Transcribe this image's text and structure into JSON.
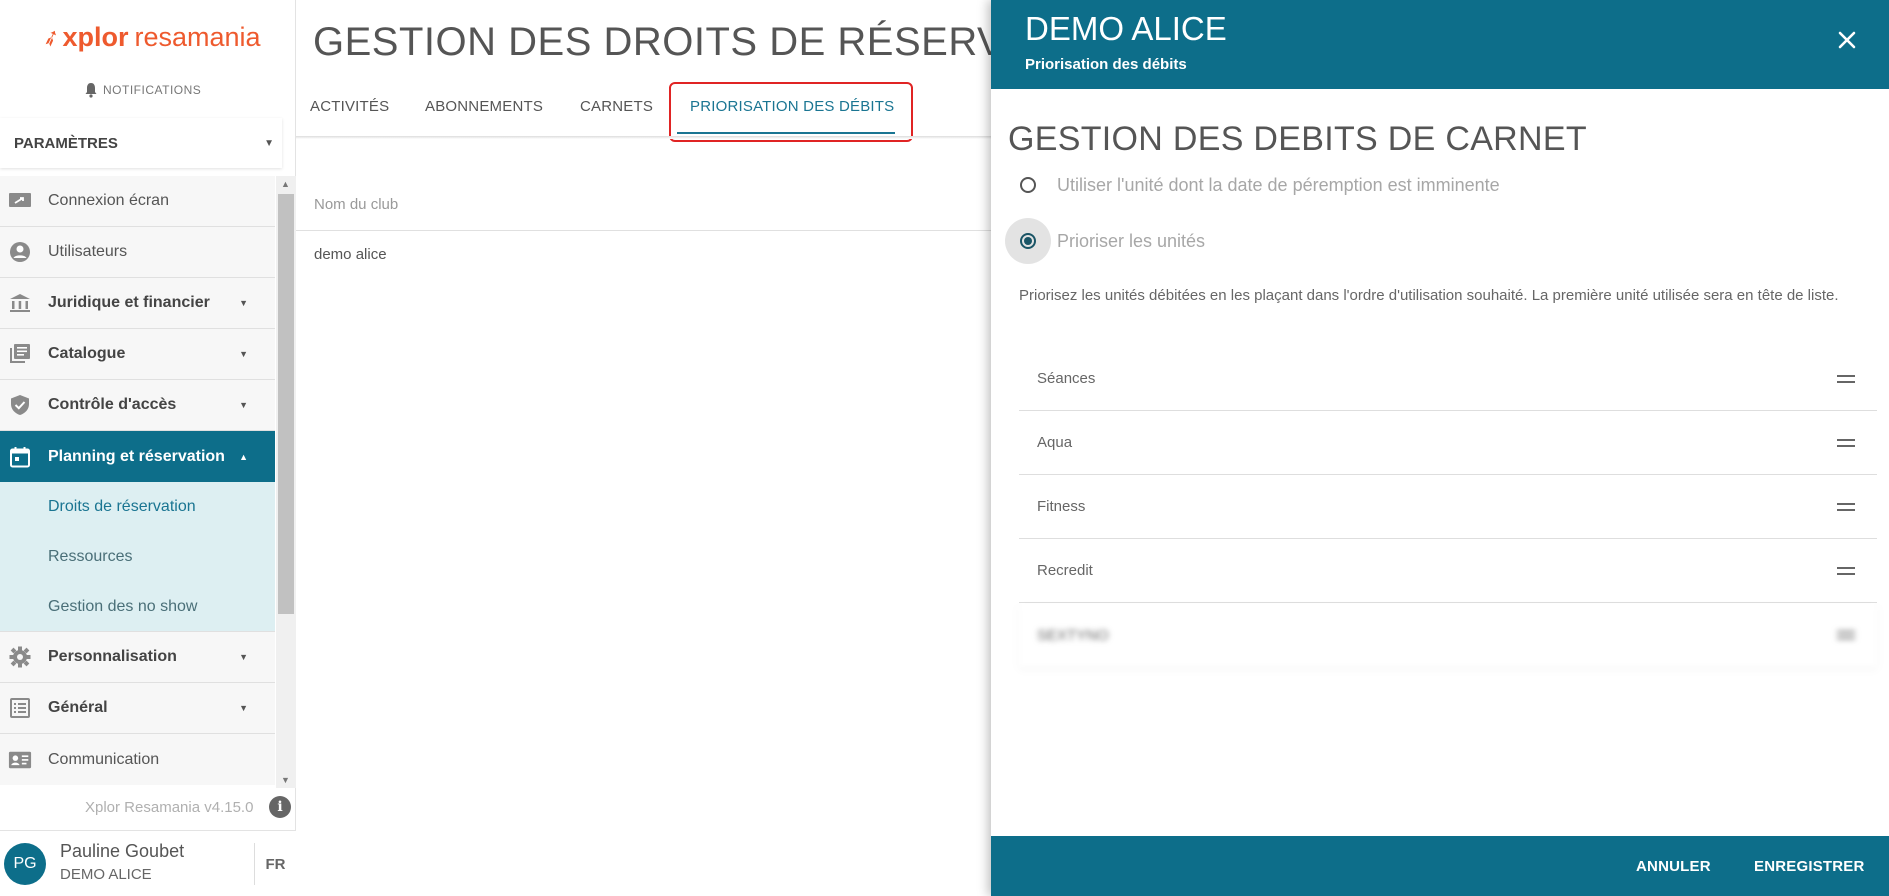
{
  "brand": {
    "logo_mark": "xplor",
    "logo_text": "resamania",
    "accent": "#0d6e8a",
    "logo_color": "#ee5a2e"
  },
  "notifications": {
    "label": "NOTIFICATIONS",
    "icon": "bell-icon"
  },
  "params": {
    "label": "PARAMÈTRES"
  },
  "menu": {
    "items": [
      {
        "label": "Connexion écran",
        "icon": "screen-login-icon"
      },
      {
        "label": "Utilisateurs",
        "icon": "user-circle-icon"
      },
      {
        "label": "Juridique et financier",
        "icon": "bank-icon"
      },
      {
        "label": "Catalogue",
        "icon": "catalog-icon"
      },
      {
        "label": "Contrôle d'accès",
        "icon": "shield-check-icon"
      },
      {
        "label": "Planning et réservation",
        "icon": "calendar-icon"
      },
      {
        "label": "Personnalisation",
        "icon": "gear-icon"
      },
      {
        "label": "Général",
        "icon": "list-icon"
      },
      {
        "label": "Communication",
        "icon": "contact-card-icon"
      }
    ],
    "subitems": [
      {
        "label": "Droits de réservation"
      },
      {
        "label": "Ressources"
      },
      {
        "label": "Gestion des no show"
      }
    ]
  },
  "version": {
    "label": "Xplor Resamania v4.15.0",
    "info": "i"
  },
  "user": {
    "initials": "PG",
    "name": "Pauline Goubet",
    "club": "DEMO ALICE",
    "lang": "FR"
  },
  "main": {
    "title": "GESTION DES DROITS DE RÉSERVATIO",
    "tabs": [
      {
        "label": "ACTIVITÉS"
      },
      {
        "label": "ABONNEMENTS"
      },
      {
        "label": "CARNETS"
      },
      {
        "label": "PRIORISATION DES DÉBITS"
      }
    ],
    "column_header": "Nom du club",
    "rows": [
      {
        "club": "demo alice"
      }
    ]
  },
  "panel": {
    "title": "DEMO ALICE",
    "subtitle": "Priorisation des débits",
    "section_title": "GESTION DES DEBITS DE CARNET",
    "options": [
      {
        "label": "Utiliser l'unité dont la date de péremption est imminente",
        "selected": false
      },
      {
        "label": "Prioriser les unités",
        "selected": true
      }
    ],
    "description": "Priorisez les unités débitées en les plaçant dans l'ordre d'utilisation souhaité. La première unité utilisée sera en tête de liste.",
    "units": [
      {
        "label": "Séances"
      },
      {
        "label": "Aqua"
      },
      {
        "label": "Fitness"
      },
      {
        "label": "Recredit"
      },
      {
        "label": "SEXTYNO"
      }
    ],
    "cancel_label": "ANNULER",
    "save_label": "ENREGISTRER"
  }
}
